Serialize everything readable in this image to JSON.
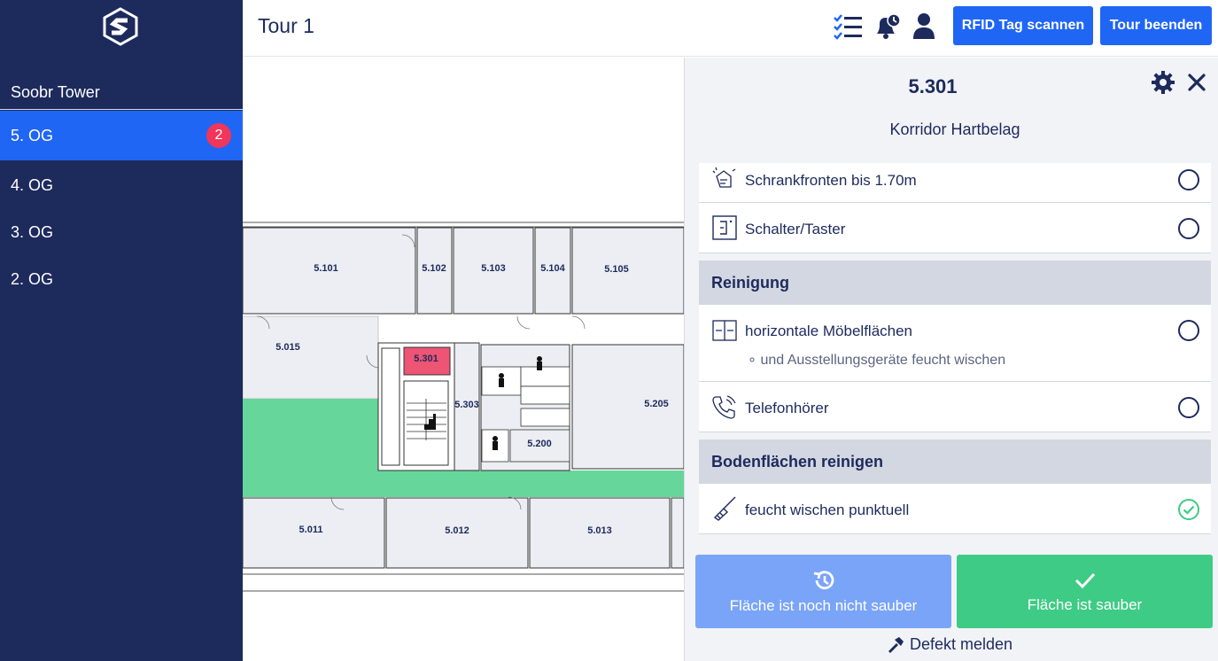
{
  "sidebar": {
    "building": "Soobr Tower",
    "floors": [
      {
        "label": "5. OG",
        "badge": "2",
        "active": true
      },
      {
        "label": "4. OG"
      },
      {
        "label": "3. OG"
      },
      {
        "label": "2. OG"
      }
    ]
  },
  "header": {
    "title": "Tour 1",
    "icons": [
      "checklist-icon",
      "bell-clock-icon",
      "user-icon"
    ],
    "scan_button": "RFID Tag scannen",
    "end_button": "Tour beenden"
  },
  "map": {
    "rooms": [
      "5.101",
      "5.102",
      "5.103",
      "5.104",
      "5.105",
      "5.015",
      "5.301",
      "5.303",
      "5.205",
      "5.200",
      "5.011",
      "5.012",
      "5.013"
    ],
    "selected_room": "5.301",
    "highlight_color": "#ee5474",
    "corridor_color": "#66d69a"
  },
  "panel": {
    "room_number": "5.301",
    "room_type": "Korridor Hartbelag",
    "items_top": [
      {
        "label": "Schrankfronten bis 1.70m",
        "icon": "spray-hand-icon",
        "done": false
      },
      {
        "label": "Schalter/Taster",
        "icon": "switch-icon",
        "done": false
      }
    ],
    "sections": [
      {
        "title": "Reinigung",
        "items": [
          {
            "label": "horizontale Möbelflächen",
            "sub": "∘ und Ausstellungsgeräte feucht wischen",
            "icon": "furniture-icon",
            "done": false
          },
          {
            "label": "Telefonhörer",
            "icon": "phone-icon",
            "done": false
          }
        ]
      },
      {
        "title": "Bodenflächen reinigen",
        "items": [
          {
            "label": "feucht wischen punktuell",
            "icon": "mop-icon",
            "done": true
          }
        ]
      }
    ],
    "not_clean_button": "Fläche ist noch nicht sauber",
    "clean_button": "Fläche ist sauber",
    "defect_link": "Defekt melden"
  },
  "colors": {
    "sidebar": "#1d2a5c",
    "accent": "#2066f5",
    "badge": "#f0365a",
    "success": "#3ecb85",
    "muted_blue": "#7aa4f8"
  }
}
